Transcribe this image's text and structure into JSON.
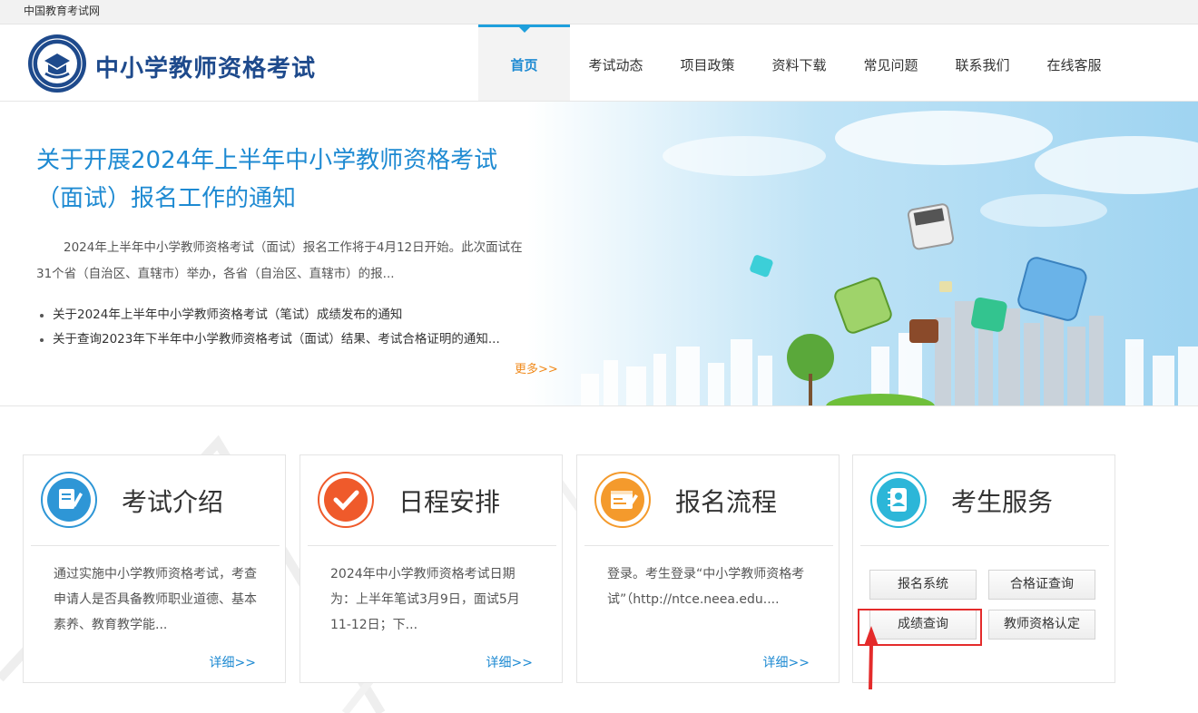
{
  "topbar": {
    "site_label": "中国教育考试网"
  },
  "header": {
    "title": "中小学教师资格考试",
    "nav": [
      {
        "label": "首页",
        "active": true
      },
      {
        "label": "考试动态"
      },
      {
        "label": "项目政策"
      },
      {
        "label": "资料下载"
      },
      {
        "label": "常见问题"
      },
      {
        "label": "联系我们"
      },
      {
        "label": "在线客服"
      }
    ]
  },
  "banner": {
    "headline": "关于开展2024年上半年中小学教师资格考试（面试）报名工作的通知",
    "summary": "2024年上半年中小学教师资格考试（面试）报名工作将于4月12日开始。此次面试在31个省（自治区、直辖市）举办，各省（自治区、直辖市）的报...",
    "news": [
      "关于2024年上半年中小学教师资格考试（笔试）成绩发布的通知",
      "关于查询2023年下半年中小学教师资格考试（面试）结果、考试合格证明的通知..."
    ],
    "more_label": "更多>>"
  },
  "cards": [
    {
      "title": "考试介绍",
      "icon": "document-pen-icon",
      "color": "#2e96d6",
      "desc": "通过实施中小学教师资格考试，考查申请人是否具备教师职业道德、基本素养、教育教学能...",
      "detail_label": "详细>>"
    },
    {
      "title": "日程安排",
      "icon": "checkmark-icon",
      "color": "#ef5a2b",
      "desc": "2024年中小学教师资格考试日期为：上半年笔试3月9日，面试5月11-12日；下...",
      "detail_label": "详细>>"
    },
    {
      "title": "报名流程",
      "icon": "form-edit-icon",
      "color": "#f49a2c",
      "desc": "登录。考生登录“中小学教师资格考试”（http://ntce.neea.edu....",
      "detail_label": "详细>>"
    },
    {
      "title": "考生服务",
      "icon": "contact-book-icon",
      "color": "#2cb6d8",
      "buttons": [
        "报名系统",
        "合格证查询",
        "成绩查询",
        "教师资格认定"
      ]
    }
  ],
  "annotation": {
    "highlight_color": "#e42b2b"
  }
}
